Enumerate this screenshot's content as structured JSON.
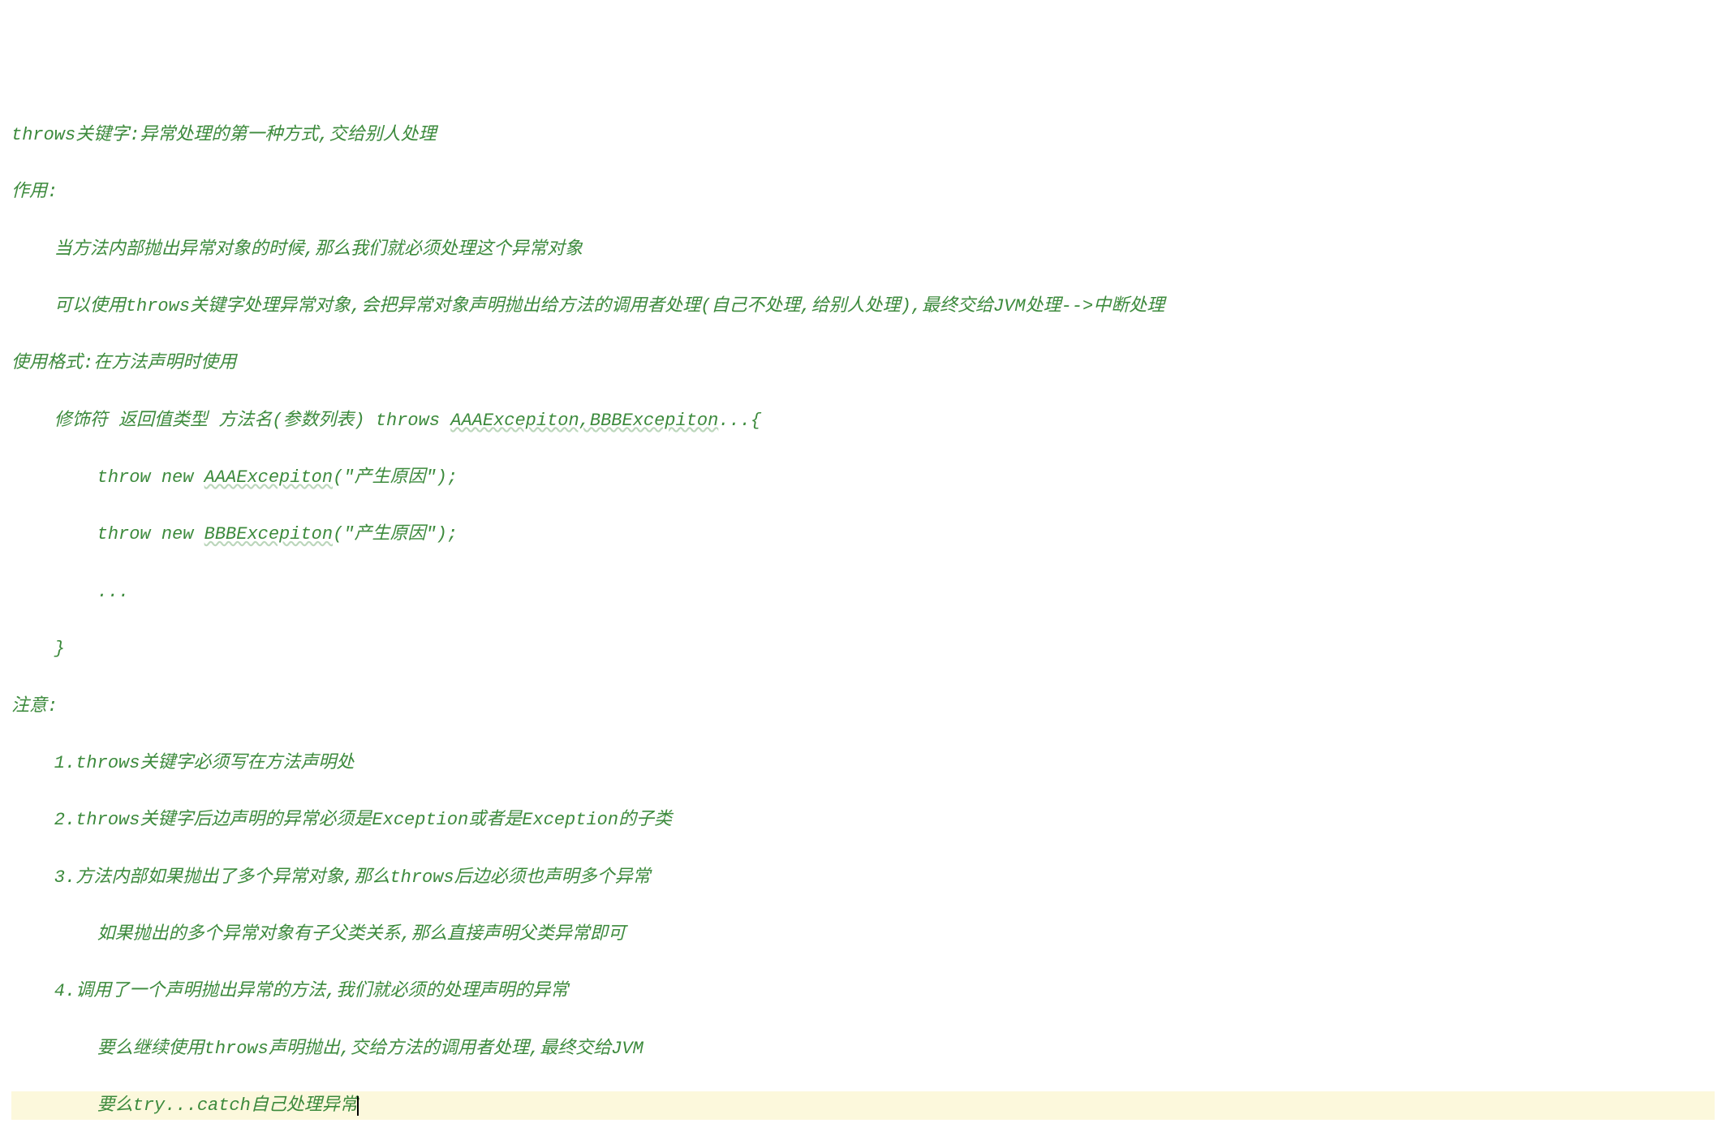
{
  "lines": {
    "l1": "throws关键字:异常处理的第一种方式,交给别人处理",
    "l2": "作用:",
    "l3": "    当方法内部抛出异常对象的时候,那么我们就必须处理这个异常对象",
    "l4": "    可以使用throws关键字处理异常对象,会把异常对象声明抛出给方法的调用者处理(自己不处理,给别人处理),最终交给JVM处理-->中断处理",
    "l5": "使用格式:在方法声明时使用",
    "l6a": "    修饰符 返回值类型 方法名(参数列表) throws ",
    "l6b": "AAAExcepiton,BBBExcepiton",
    "l6c": "...{",
    "l7a": "        throw new ",
    "l7b": "AAAExcepiton",
    "l7c": "(\"产生原因\");",
    "l8a": "        throw new ",
    "l8b": "BBBExcepiton",
    "l8c": "(\"产生原因\");",
    "l9": "        ...",
    "l10": "    }",
    "l11": "注意:",
    "l12": "    1.throws关键字必须写在方法声明处",
    "l13": "    2.throws关键字后边声明的异常必须是Exception或者是Exception的子类",
    "l14": "    3.方法内部如果抛出了多个异常对象,那么throws后边必须也声明多个异常",
    "l15": "        如果抛出的多个异常对象有子父类关系,那么直接声明父类异常即可",
    "l16": "    4.调用了一个声明抛出异常的方法,我们就必须的处理声明的异常",
    "l17": "        要么继续使用throws声明抛出,交给方法的调用者处理,最终交给JVM",
    "l18": "        要么try...catch自己处理异常"
  }
}
